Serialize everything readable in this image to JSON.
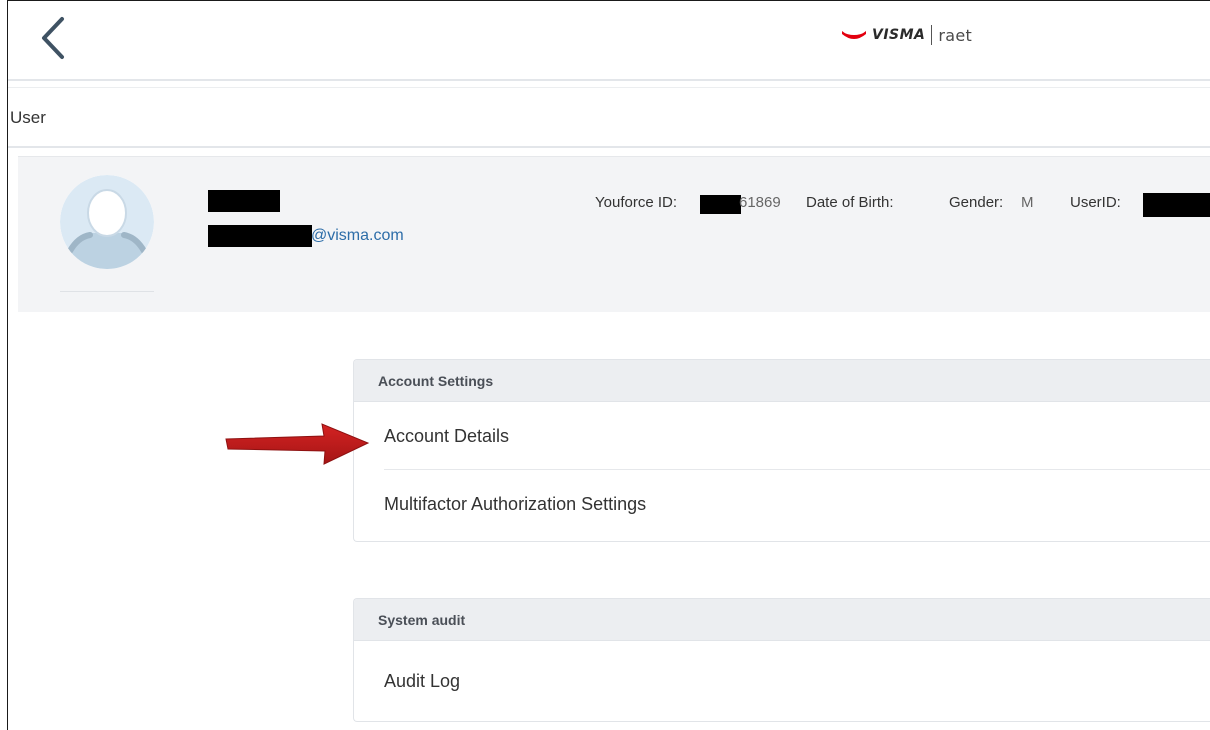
{
  "header": {
    "back_icon": "chevron-left-icon",
    "logo": {
      "brand": "VISMA",
      "product": "raet",
      "brand_color": "#e3000f"
    }
  },
  "page": {
    "title": "User"
  },
  "profile": {
    "email_suffix": "@visma.com",
    "youforce_id_label": "Youforce ID:",
    "youforce_id_visible": "61869",
    "dob_label": "Date of Birth:",
    "gender_label": "Gender:",
    "gender_value": "M",
    "userid_label": "UserID:",
    "email_color": "#2d6da8"
  },
  "sections": [
    {
      "header": "Account Settings",
      "items": [
        {
          "label": "Account Details"
        },
        {
          "label": "Multifactor Authorization Settings"
        }
      ]
    },
    {
      "header": "System audit",
      "items": [
        {
          "label": "Audit Log"
        }
      ]
    }
  ],
  "annotation": {
    "arrow_color": "#c01a1a"
  }
}
